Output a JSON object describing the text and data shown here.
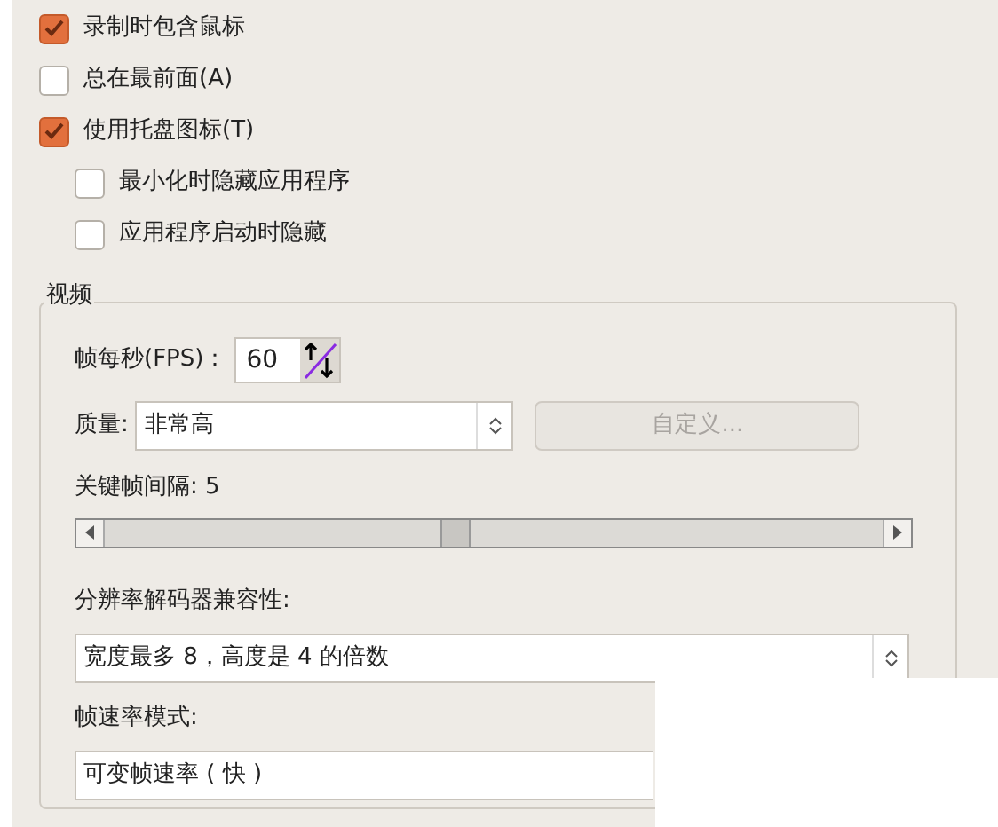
{
  "options": [
    {
      "label": "录制时包含鼠标",
      "checked": true
    },
    {
      "label": "总在最前面(A)",
      "checked": false
    },
    {
      "label": "使用托盘图标(T)",
      "checked": true,
      "children": [
        {
          "label": "最小化时隐藏应用程序",
          "checked": false
        },
        {
          "label": "应用程序启动时隐藏",
          "checked": false
        }
      ]
    }
  ],
  "video": {
    "title": "视频",
    "fps": {
      "label": "帧每秒(FPS)：",
      "value": "60"
    },
    "quality": {
      "label": "质量:",
      "value": "非常高",
      "custom_button": {
        "label": "自定义...",
        "disabled": true
      }
    },
    "keyframe": {
      "label": "关键帧间隔: 5",
      "level": 0.45
    },
    "resolution": {
      "label": "分辨率解码器兼容性:",
      "value": "宽度最多 8，高度是 4 的倍数"
    },
    "framerate": {
      "label": "帧速率模式:",
      "value": "可变帧速率 ( 快 )"
    }
  }
}
